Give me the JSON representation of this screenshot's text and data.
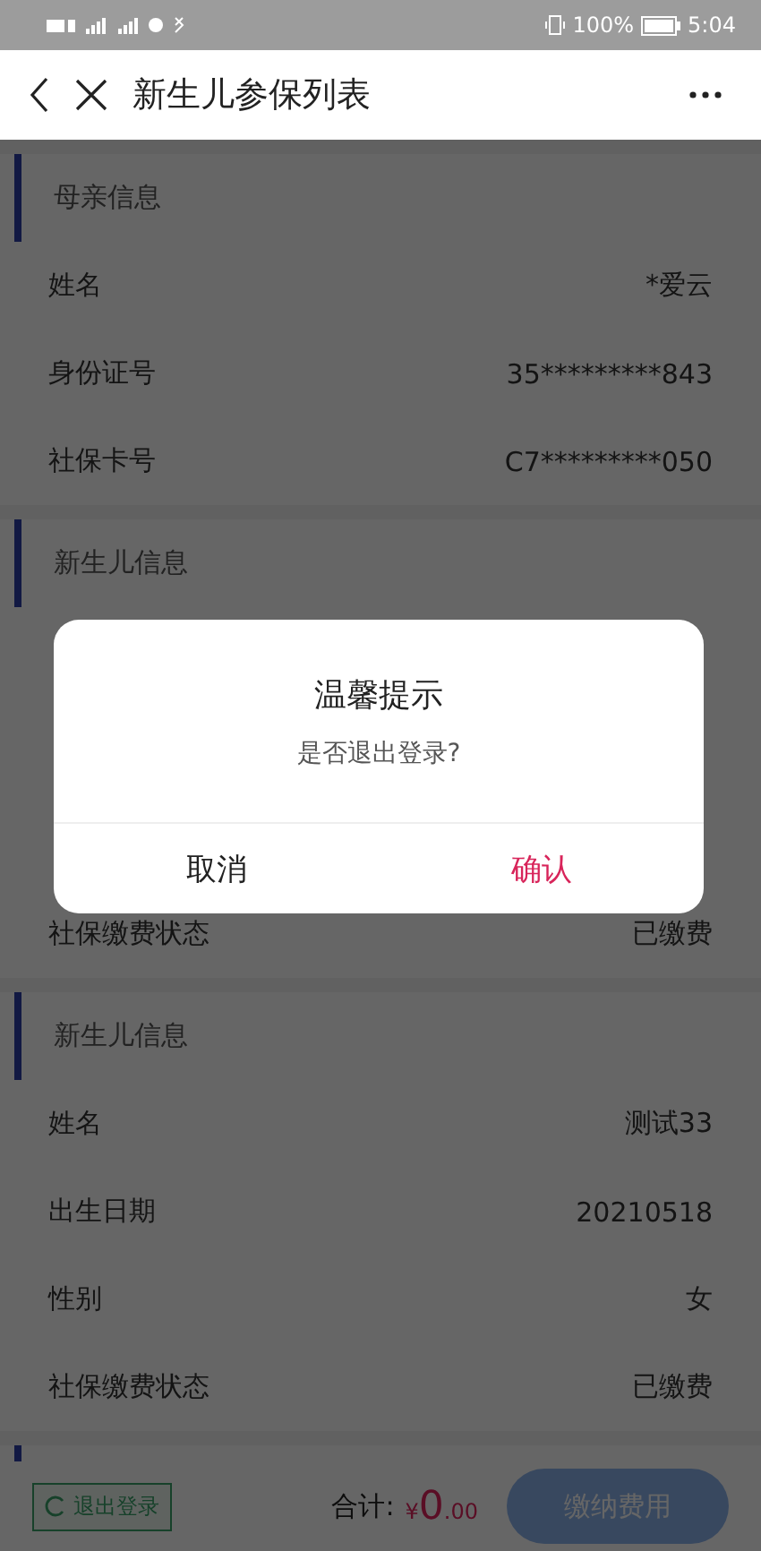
{
  "status_bar": {
    "battery": "100%",
    "time": "5:04"
  },
  "nav": {
    "title": "新生儿参保列表"
  },
  "sections": [
    {
      "title": "母亲信息",
      "rows": [
        {
          "label": "姓名",
          "value": "*爱云"
        },
        {
          "label": "身份证号",
          "value": "35*********843"
        },
        {
          "label": "社保卡号",
          "value": "C7*********050"
        }
      ]
    },
    {
      "title": "新生儿信息",
      "rows": [
        {
          "label": "社保缴费状态",
          "value": "已缴费"
        }
      ]
    },
    {
      "title": "新生儿信息",
      "rows": [
        {
          "label": "姓名",
          "value": "测试33"
        },
        {
          "label": "出生日期",
          "value": "20210518"
        },
        {
          "label": "性别",
          "value": "女"
        },
        {
          "label": "社保缴费状态",
          "value": "已缴费"
        }
      ]
    }
  ],
  "footer": {
    "logout": "退出登录",
    "total_label": "合计:",
    "currency": "¥",
    "amount_int": "0",
    "amount_dec": ".00",
    "pay_button": "缴纳费用"
  },
  "dialog": {
    "title": "温馨提示",
    "message": "是否退出登录?",
    "cancel": "取消",
    "confirm": "确认"
  }
}
